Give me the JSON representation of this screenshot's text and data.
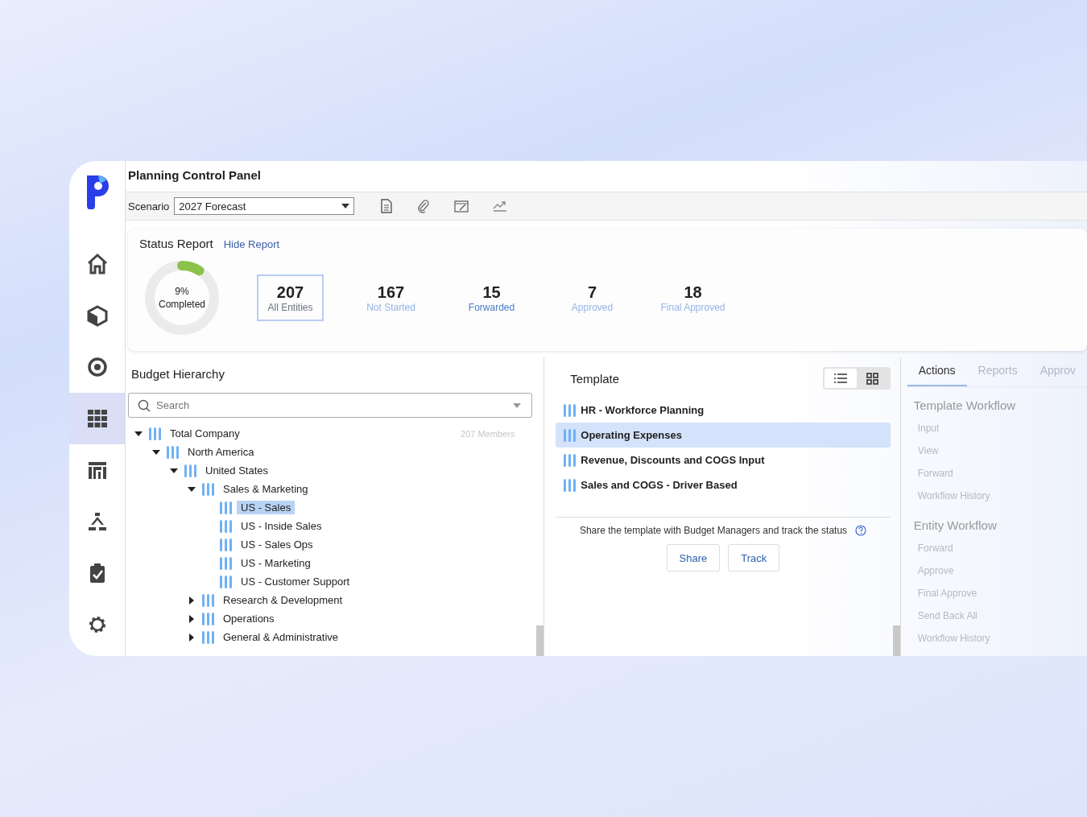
{
  "window": {
    "title": "Planning Control Panel"
  },
  "sidebar": {
    "items": [
      {
        "selected": false
      },
      {
        "selected": false
      },
      {
        "selected": false
      },
      {
        "selected": true
      },
      {
        "selected": false
      },
      {
        "selected": false
      },
      {
        "selected": false
      },
      {
        "selected": false
      }
    ]
  },
  "toolbar": {
    "scenario_label": "Scenario",
    "scenario_value": "2027 Forecast"
  },
  "status_report": {
    "title": "Status Report",
    "hide_link": "Hide Report",
    "progress": {
      "level": 0.09,
      "percent": "9%",
      "label": "Completed"
    },
    "stats": [
      {
        "value": "207",
        "label": "All Entities",
        "selected": true,
        "color": "#6b7280"
      },
      {
        "value": "167",
        "label": "Not Started",
        "selected": false,
        "color": "#93b4e8"
      },
      {
        "value": "15",
        "label": "Forwarded",
        "selected": false,
        "color": "#4a7cc9"
      },
      {
        "value": "7",
        "label": "Approved",
        "selected": false,
        "color": "#93b4e8"
      },
      {
        "value": "18",
        "label": "Final Approved",
        "selected": false,
        "color": "#93b4e8"
      }
    ]
  },
  "budget_hierarchy": {
    "title": "Budget Hierarchy",
    "search": {
      "placeholder": "Search"
    },
    "member_count": "207 Members",
    "tree": [
      {
        "label": "Total Company",
        "expanded": true,
        "selected": false,
        "children": [
          {
            "label": "North America",
            "expanded": true,
            "selected": false,
            "children": [
              {
                "label": "United States",
                "expanded": true,
                "selected": false,
                "children": [
                  {
                    "label": "Sales & Marketing",
                    "expanded": true,
                    "selected": false,
                    "children": [
                      {
                        "label": "US - Sales",
                        "selected": true
                      },
                      {
                        "label": "US - Inside Sales",
                        "selected": false
                      },
                      {
                        "label": "US - Sales Ops",
                        "selected": false
                      },
                      {
                        "label": "US - Marketing",
                        "selected": false
                      },
                      {
                        "label": "US - Customer Support",
                        "selected": false
                      }
                    ]
                  },
                  {
                    "label": "Research & Development",
                    "expanded": false,
                    "selected": false
                  },
                  {
                    "label": "Operations",
                    "expanded": false,
                    "selected": false
                  },
                  {
                    "label": "General & Administrative",
                    "expanded": false,
                    "selected": false
                  }
                ]
              }
            ]
          }
        ]
      }
    ]
  },
  "template": {
    "title": "Template",
    "views": [
      {
        "selected": true
      },
      {
        "selected": false
      }
    ],
    "items": [
      {
        "label": "HR - Workforce Planning",
        "selected": false
      },
      {
        "label": "Operating Expenses",
        "selected": true
      },
      {
        "label": "Revenue, Discounts and COGS Input",
        "selected": false
      },
      {
        "label": "Sales and COGS - Driver Based",
        "selected": false
      }
    ],
    "hint": "Share the template with Budget Managers and track the status",
    "buttons": [
      "Share",
      "Track"
    ]
  },
  "actions_panel": {
    "tabs": [
      {
        "label": "Actions",
        "selected": true
      },
      {
        "label": "Reports",
        "selected": false
      },
      {
        "label": "Approv",
        "selected": false
      }
    ],
    "sections": [
      {
        "title": "Template Workflow",
        "items": [
          "Input",
          "View",
          "Forward",
          "Workflow History"
        ]
      },
      {
        "title": "Entity Workflow",
        "items": [
          "Forward",
          "Approve",
          "Final Approve",
          "Send Back All",
          "Workflow History"
        ]
      }
    ]
  }
}
